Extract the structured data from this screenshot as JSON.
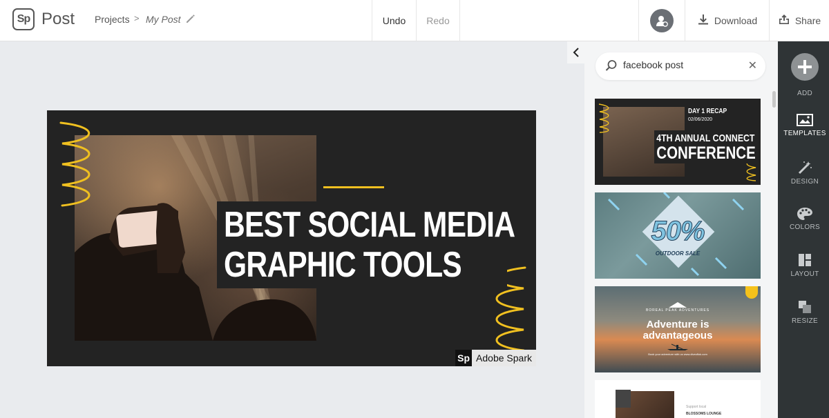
{
  "app": {
    "logo_mark": "Sp",
    "name": "Post"
  },
  "breadcrumb": {
    "projects": "Projects",
    "separator": ">",
    "current": "My Post"
  },
  "toolbar": {
    "undo": "Undo",
    "redo": "Redo",
    "download": "Download",
    "share": "Share"
  },
  "canvas": {
    "headline_line1": "BEST SOCIAL MEDIA",
    "headline_line2": "GRAPHIC TOOLS",
    "watermark_logo": "Sp",
    "watermark_text": "Adobe Spark"
  },
  "search": {
    "value": "facebook post"
  },
  "templates": [
    {
      "day": "DAY 1 RECAP",
      "date": "02/06/2020",
      "line1": "4TH ANNUAL CONNECT",
      "line2": "CONFERENCE"
    },
    {
      "headline": "50%",
      "sub": "OUTDOOR SALE"
    },
    {
      "brand": "BOREAL PEAK ADVENTURES",
      "line1": "Adventure is",
      "line2": "advantageous",
      "footer": "Book your adventure with us www.diveoflok.com"
    },
    {
      "label": "Support local",
      "title": "BLOSSOMS LOUNGE"
    }
  ],
  "rail": {
    "add": "ADD",
    "templates": "TEMPLATES",
    "design": "DESIGN",
    "colors": "COLORS",
    "layout": "LAYOUT",
    "resize": "RESIZE"
  },
  "colors": {
    "accent_gold": "#f0c020",
    "rail_bg": "#2f3436",
    "canvas_bg": "#232323"
  }
}
